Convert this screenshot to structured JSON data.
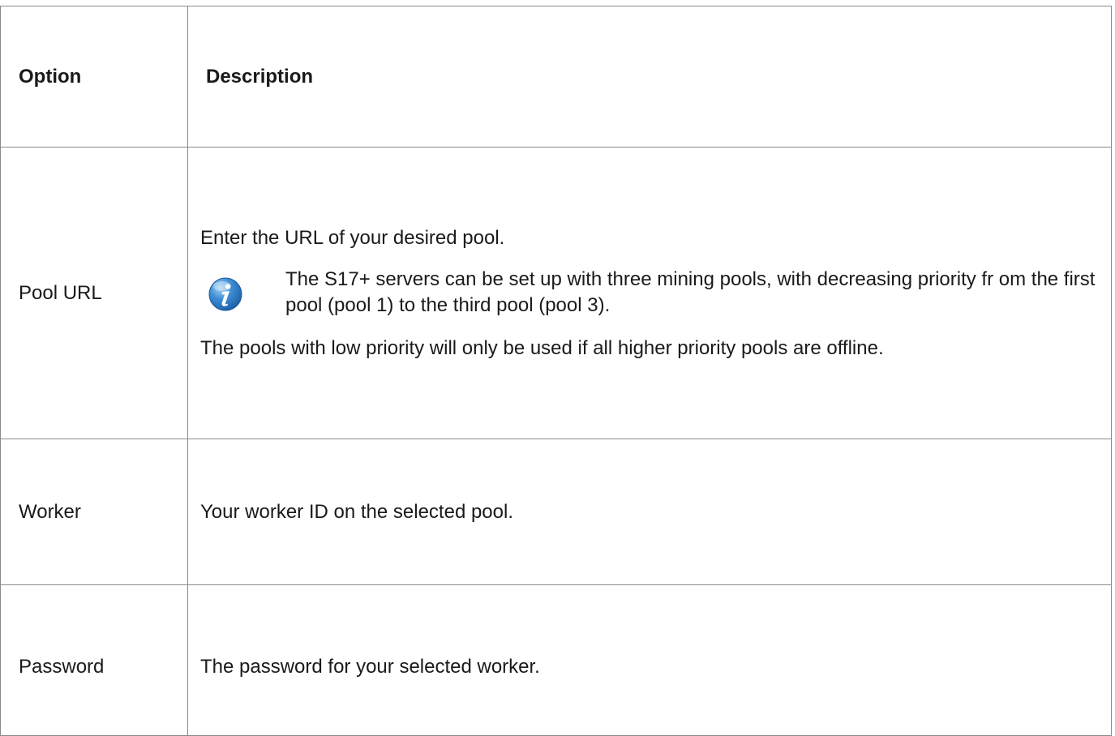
{
  "table": {
    "headers": {
      "option": "Option",
      "description": "Description"
    },
    "rows": [
      {
        "option": "Pool URL",
        "intro": "Enter the URL of your desired pool.",
        "note_icon": "info-icon",
        "note": "The S17+ servers can be set up with three mining pools, with decreasing priority fr om the first pool (pool 1) to the third pool (pool 3).",
        "outro": "The pools with low priority will only be used if all higher priority pools are offline."
      },
      {
        "option": "Worker",
        "description": "Your worker ID on the selected pool."
      },
      {
        "option": "Password",
        "description": "The password for your selected worker."
      }
    ]
  },
  "colors": {
    "border": "#8a8a8a",
    "text": "#1a1a1a",
    "icon_blue": "#2f7fc8"
  }
}
